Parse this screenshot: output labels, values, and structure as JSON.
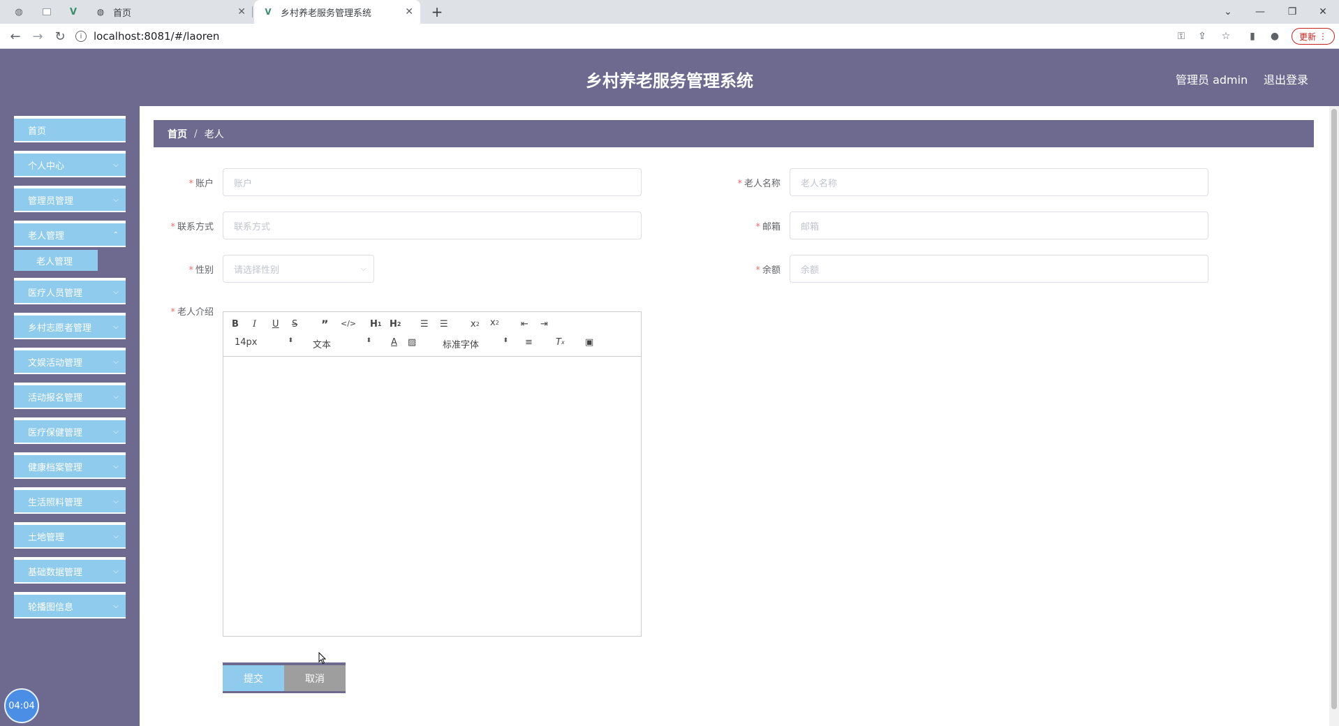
{
  "browser": {
    "tabs": [
      {
        "label": "首页",
        "icon": "globe-icon"
      },
      {
        "label": "乡村养老服务管理系统",
        "icon": "vue-logo-icon"
      }
    ],
    "url": "localhost:8081/#/laoren",
    "update_label": "更新"
  },
  "header": {
    "title": "乡村养老服务管理系统",
    "user": "管理员 admin",
    "logout": "退出登录"
  },
  "sidebar": {
    "items": [
      {
        "label": "首页"
      },
      {
        "label": "个人中心"
      },
      {
        "label": "管理员管理"
      },
      {
        "label": "老人管理"
      },
      {
        "label": "医疗人员管理"
      },
      {
        "label": "乡村志愿者管理"
      },
      {
        "label": "文娱活动管理"
      },
      {
        "label": "活动报名管理"
      },
      {
        "label": "医疗保健管理"
      },
      {
        "label": "健康档案管理"
      },
      {
        "label": "生活照料管理"
      },
      {
        "label": "土地管理"
      },
      {
        "label": "基础数据管理"
      },
      {
        "label": "轮播图信息"
      }
    ],
    "submenu": {
      "label": "老人管理"
    },
    "clock": "04:04"
  },
  "breadcrumb": {
    "home": "首页",
    "sep": "/",
    "current": "老人"
  },
  "form": {
    "account": {
      "label": "账户",
      "placeholder": "账户"
    },
    "name": {
      "label": "老人名称",
      "placeholder": "老人名称"
    },
    "phone": {
      "label": "联系方式",
      "placeholder": "联系方式"
    },
    "email": {
      "label": "邮箱",
      "placeholder": "邮箱"
    },
    "gender": {
      "label": "性别",
      "placeholder": "请选择性别"
    },
    "balance": {
      "label": "余额",
      "placeholder": "余额"
    },
    "intro": {
      "label": "老人介绍"
    },
    "editor": {
      "font_size": "14px",
      "format": "文本",
      "font_family": "标准字体"
    },
    "submit": "提交",
    "cancel": "取消"
  }
}
